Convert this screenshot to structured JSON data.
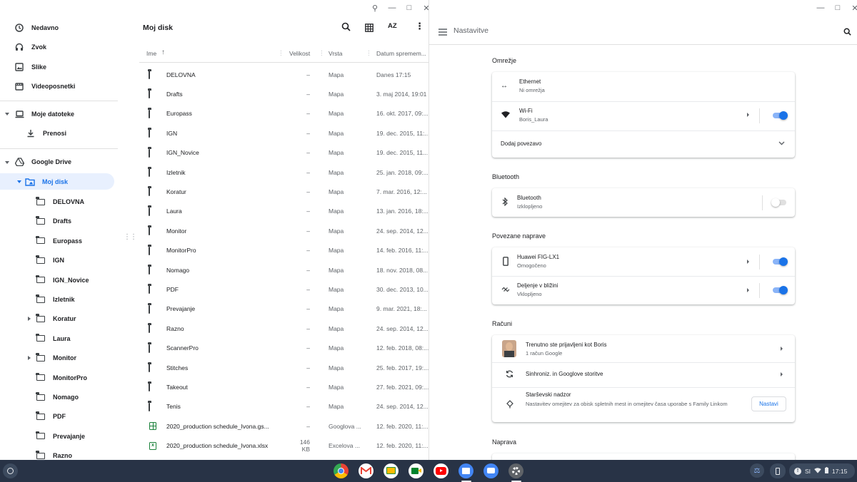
{
  "files_window": {
    "title": "Moj disk",
    "sidebar": {
      "recent": "Nedavno",
      "audio": "Zvok",
      "images": "Slike",
      "videos": "Videoposnetki",
      "my_files": "Moje datoteke",
      "downloads": "Prenosi",
      "google_drive": "Google Drive",
      "my_drive": "Moj disk",
      "folders": [
        "DELOVNA",
        "Drafts",
        "Europass",
        "IGN",
        "IGN_Novice",
        "Izletnik",
        "Koratur",
        "Laura",
        "Monitor",
        "MonitorPro",
        "Nomago",
        "PDF",
        "Prevajanje",
        "Razno"
      ]
    },
    "columns": {
      "name": "Ime",
      "size": "Velikost",
      "type": "Vrsta",
      "date": "Datum spremem..."
    },
    "rows": [
      {
        "name": "DELOVNA",
        "size": "–",
        "type": "Mapa",
        "date": "Danes 17:15",
        "kind": "folder"
      },
      {
        "name": "Drafts",
        "size": "–",
        "type": "Mapa",
        "date": "3. maj 2014, 19:01",
        "kind": "folder"
      },
      {
        "name": "Europass",
        "size": "–",
        "type": "Mapa",
        "date": "16. okt. 2017, 09:...",
        "kind": "folder"
      },
      {
        "name": "IGN",
        "size": "–",
        "type": "Mapa",
        "date": "19. dec. 2015, 11:...",
        "kind": "folder"
      },
      {
        "name": "IGN_Novice",
        "size": "–",
        "type": "Mapa",
        "date": "19. dec. 2015, 11...",
        "kind": "folder"
      },
      {
        "name": "Izletnik",
        "size": "–",
        "type": "Mapa",
        "date": "25. jan. 2018, 09:...",
        "kind": "folder"
      },
      {
        "name": "Koratur",
        "size": "–",
        "type": "Mapa",
        "date": "7. mar. 2016, 12:...",
        "kind": "folder"
      },
      {
        "name": "Laura",
        "size": "–",
        "type": "Mapa",
        "date": "13. jan. 2016, 18:...",
        "kind": "folder"
      },
      {
        "name": "Monitor",
        "size": "–",
        "type": "Mapa",
        "date": "24. sep. 2014, 12...",
        "kind": "folder"
      },
      {
        "name": "MonitorPro",
        "size": "–",
        "type": "Mapa",
        "date": "14. feb. 2016, 11:...",
        "kind": "folder"
      },
      {
        "name": "Nomago",
        "size": "–",
        "type": "Mapa",
        "date": "18. nov. 2018, 08...",
        "kind": "folder"
      },
      {
        "name": "PDF",
        "size": "–",
        "type": "Mapa",
        "date": "30. dec. 2013, 10...",
        "kind": "folder"
      },
      {
        "name": "Prevajanje",
        "size": "–",
        "type": "Mapa",
        "date": "9. mar. 2021, 18:...",
        "kind": "folder"
      },
      {
        "name": "Razno",
        "size": "–",
        "type": "Mapa",
        "date": "24. sep. 2014, 12...",
        "kind": "folder"
      },
      {
        "name": "ScannerPro",
        "size": "–",
        "type": "Mapa",
        "date": "12. feb. 2018, 08:...",
        "kind": "folder"
      },
      {
        "name": "Stitches",
        "size": "–",
        "type": "Mapa",
        "date": "25. feb. 2017, 19:...",
        "kind": "folder"
      },
      {
        "name": "Takeout",
        "size": "–",
        "type": "Mapa",
        "date": "27. feb. 2021, 09:...",
        "kind": "folder"
      },
      {
        "name": "Tenis",
        "size": "–",
        "type": "Mapa",
        "date": "24. sep. 2014, 12...",
        "kind": "folder"
      },
      {
        "name": "2020_production schedule_Ivona.gs...",
        "size": "–",
        "type": "Googlova ...",
        "date": "12. feb. 2020, 11:...",
        "kind": "gsheet"
      },
      {
        "name": "2020_production schedule_Ivona.xlsx",
        "size": "146 KB",
        "type": "Excelova ...",
        "date": "12. feb. 2020, 11:...",
        "kind": "xlsx"
      }
    ],
    "sort_label": "AZ"
  },
  "settings_window": {
    "title": "Nastavitve",
    "network": {
      "heading": "Omrežje",
      "ethernet_title": "Ethernet",
      "ethernet_status": "Ni omrežja",
      "wifi_title": "Wi-Fi",
      "wifi_status": "Boris_Laura",
      "wifi_on": true,
      "add_connection": "Dodaj povezavo"
    },
    "bluetooth": {
      "heading": "Bluetooth",
      "title": "Bluetooth",
      "status": "Izklopljeno",
      "on": false
    },
    "connected_devices": {
      "heading": "Povezane naprave",
      "phone_title": "Huawei FIG-LX1",
      "phone_status": "Omogočeno",
      "phone_on": true,
      "nearby_title": "Deljenje v bližini",
      "nearby_status": "Vklopljeno",
      "nearby_on": true
    },
    "accounts": {
      "heading": "Računi",
      "signed_in_title": "Trenutno ste prijavljeni kot Boris",
      "signed_in_sub": "1 račun Google",
      "sync_title": "Sinhroniz. in Googlove storitve",
      "parental_title": "Starševski nadzor",
      "parental_desc": "Nastavitev omejitev za obisk spletnih mest in omejitev časa uporabe s Family Linkom",
      "setup_button": "Nastavi"
    },
    "device": {
      "heading": "Naprava"
    }
  },
  "shelf": {
    "locale": "SI",
    "time": "17:15",
    "accent": "#283346"
  }
}
